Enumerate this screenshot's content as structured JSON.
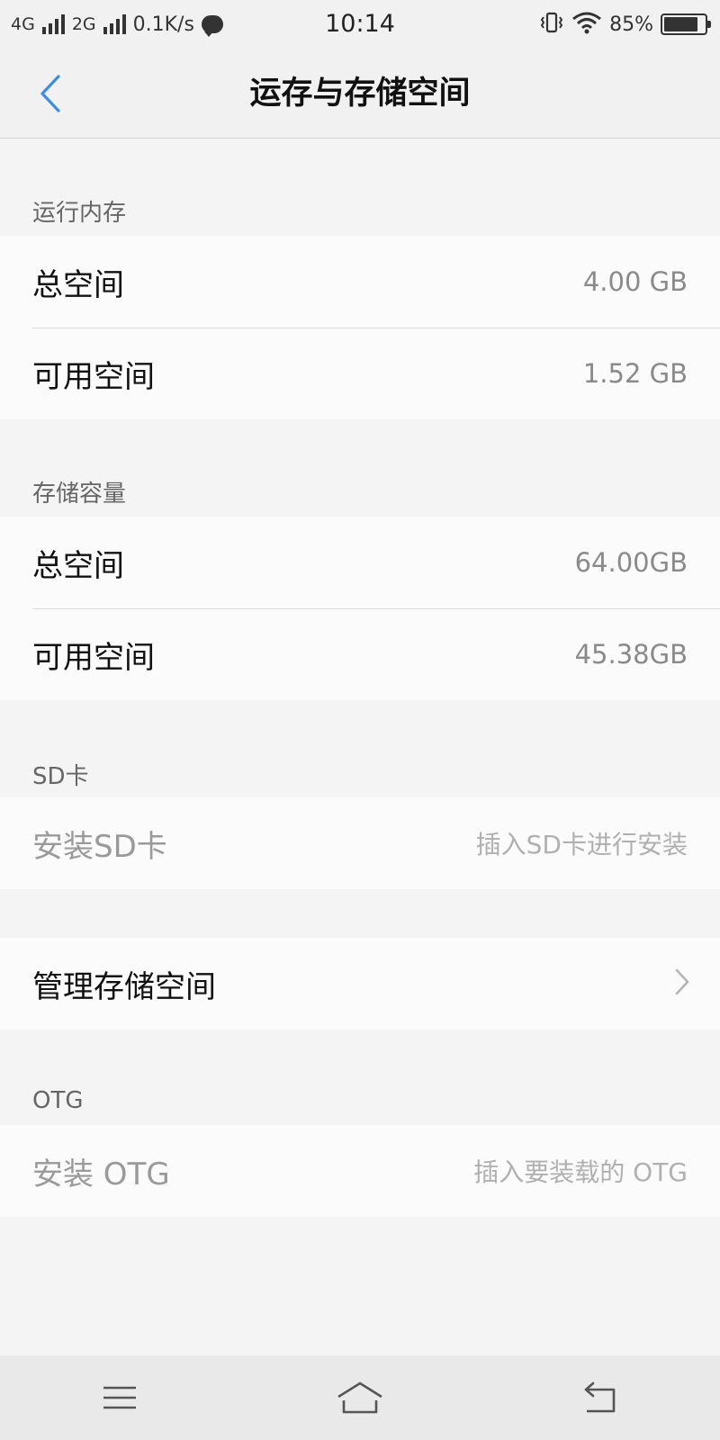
{
  "status_bar": {
    "net1": "4G",
    "net2": "2G",
    "speed": "0.1K/s",
    "time": "10:14",
    "battery": "85%",
    "battery_level": 0.85,
    "icons": [
      "signal-icon",
      "chat-bubble-icon",
      "vibrate-icon",
      "wifi-icon",
      "battery-icon"
    ]
  },
  "header": {
    "title": "运存与存储空间",
    "back_icon": "chevron-left-icon",
    "accent": "#3a8ee6"
  },
  "sections": {
    "ram": {
      "label": "运行内存",
      "total_label": "总空间",
      "total_value": "4.00 GB",
      "free_label": "可用空间",
      "free_value": "1.52 GB"
    },
    "storage": {
      "label": "存储容量",
      "total_label": "总空间",
      "total_value": "64.00GB",
      "free_label": "可用空间",
      "free_value": "45.38GB"
    },
    "sd": {
      "label": "SD卡",
      "install_label": "安装SD卡",
      "install_hint": "插入SD卡进行安装"
    },
    "manage": {
      "label": "管理存储空间",
      "chevron_icon": "chevron-right-icon"
    },
    "otg": {
      "label": "OTG",
      "install_label": "安装 OTG",
      "install_hint": "插入要装载的 OTG"
    }
  },
  "nav_bar": {
    "icons": [
      "menu-icon",
      "home-icon",
      "back-icon"
    ]
  }
}
